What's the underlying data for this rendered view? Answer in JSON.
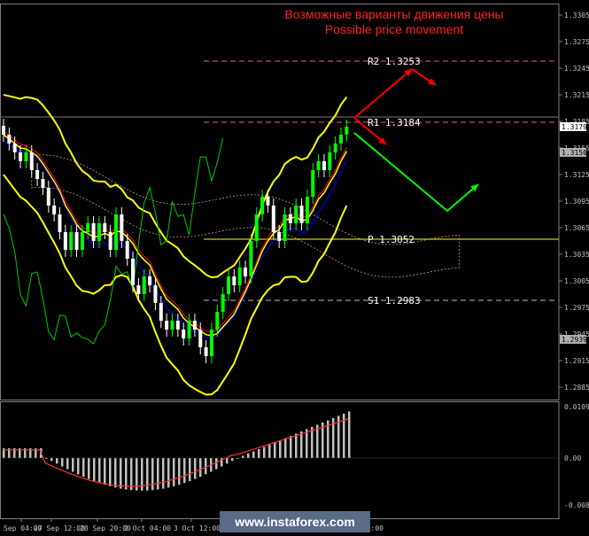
{
  "chart_data": {
    "type": "candlestick",
    "title_ru": "Возможные варианты движения цены",
    "title_en": "Possible price movement",
    "price_axis": {
      "ylim": [
        1.2885,
        1.3305
      ],
      "ticks": [
        "1.3305",
        "1.3275",
        "1.3245",
        "1.3215",
        "1.3185",
        "1.3155",
        "1.3125",
        "1.3095",
        "1.3065",
        "1.3035",
        "1.3005",
        "1.2975",
        "1.2945",
        "1.2915",
        "1.2885"
      ],
      "badges": [
        {
          "label": "1.3179",
          "value": 1.3179,
          "color": "#ffffff"
        },
        {
          "label": "1.3150",
          "value": 1.315,
          "color": "#b0b0b0"
        },
        {
          "label": "1.2939",
          "value": 1.2939,
          "color": "#b0b0b0"
        }
      ]
    },
    "osc_axis": {
      "ticks": [
        "0.01094",
        "0.00",
        "-0.00867"
      ],
      "ylim": [
        -0.00867,
        0.01094
      ]
    },
    "x_labels": [
      "Sep 04:00",
      "27 Sep 12:00",
      "28 Sep 20:00",
      "2 Oct 04:00",
      "3 Oct 12:00",
      "4 Oct 20:00",
      "5 Oct 04:00",
      "8 Oct 12:00"
    ],
    "levels": [
      {
        "label": "R2 1.3253",
        "value": 1.3253,
        "color": "#e06666",
        "style": "dashed"
      },
      {
        "label": "R1 1.3184",
        "value": 1.3184,
        "color": "#e06666",
        "style": "dashed"
      },
      {
        "label": "P 1.3052",
        "value": 1.3052,
        "color": "#ffff00",
        "style": "solid"
      },
      {
        "label": "S1 1.2983",
        "value": 1.2983,
        "color": "#c0c0c0",
        "style": "dashed"
      }
    ],
    "colors": {
      "bull": "#00ff00",
      "bear": "#ffffff",
      "bollinger": "#ffff00",
      "tenkan": "#ff0000",
      "kijun": "#0000ff",
      "chikou": "#00cc00",
      "histogram": "#c0c0c0",
      "signal": "#ff3333",
      "arrow_up": "#ff0000",
      "arrow_down": "#00ff00"
    }
  },
  "watermark": "www.instaforex.com"
}
